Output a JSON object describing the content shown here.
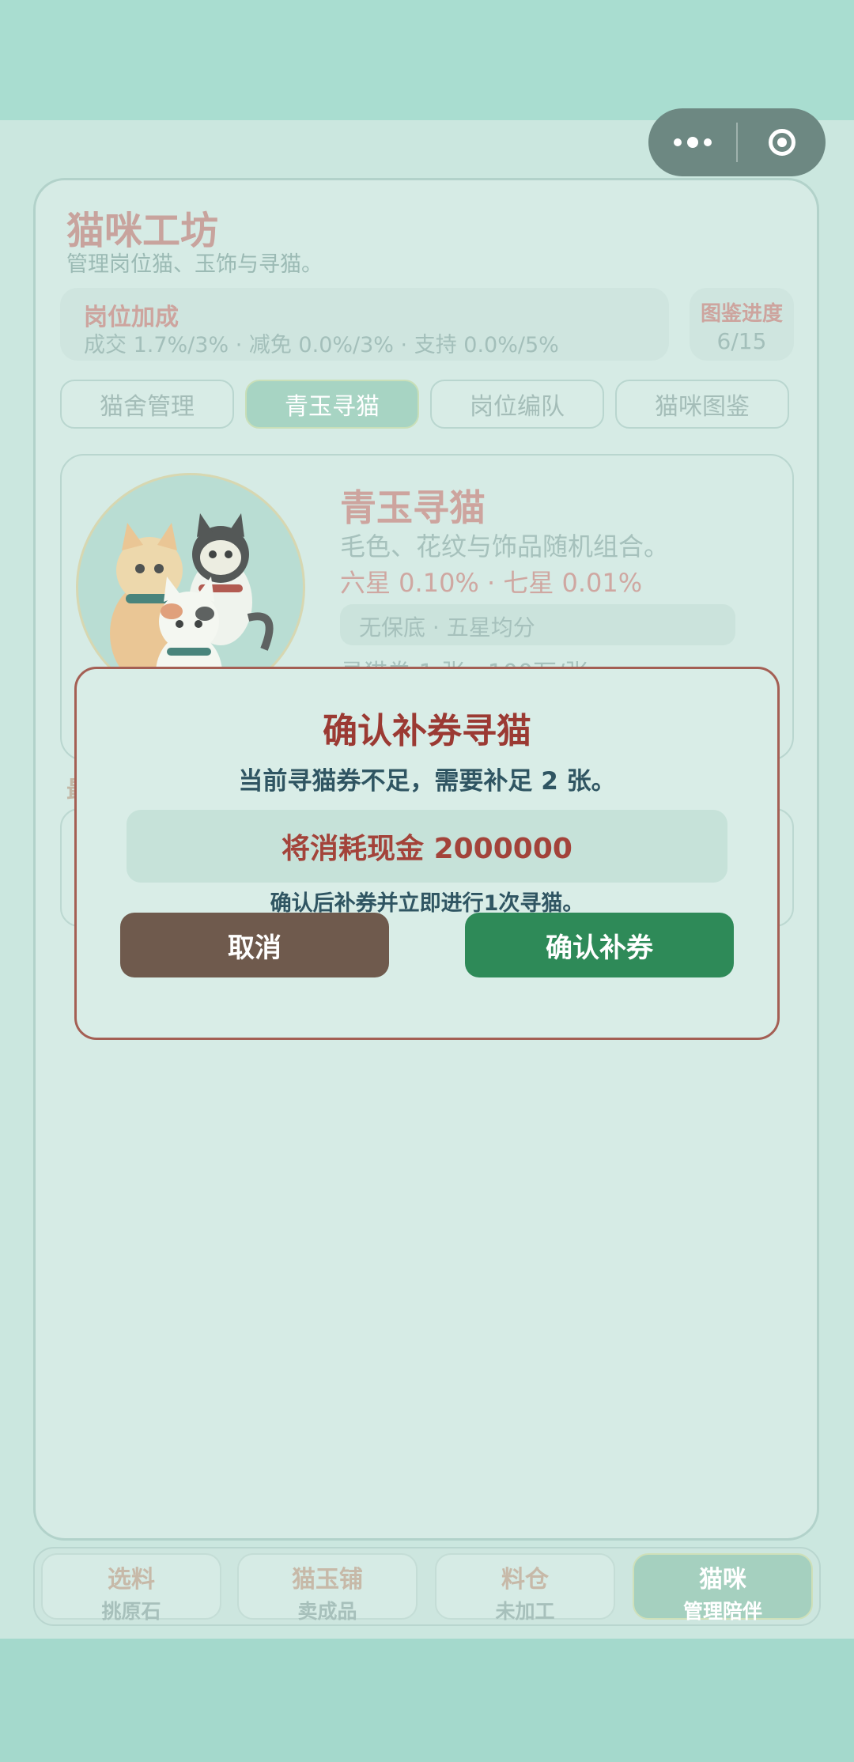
{
  "header": {
    "title": "猫咪工坊",
    "subtitle": "管理岗位猫、玉饰与寻猫。"
  },
  "capsule": {
    "more_icon": "more-dots-icon",
    "close_icon": "target-circle-icon"
  },
  "bonus": {
    "label": "岗位加成",
    "stats": "成交 1.7%/3% · 减免 0.0%/3% · 支持 0.0%/5%"
  },
  "codex": {
    "label": "图鉴进度",
    "value": "6/15"
  },
  "tabs": [
    {
      "label": "猫舍管理"
    },
    {
      "label": "青玉寻猫",
      "active": true
    },
    {
      "label": "岗位编队"
    },
    {
      "label": "猫咪图鉴"
    }
  ],
  "gacha": {
    "title": "青玉寻猫",
    "desc": "毛色、花纹与饰品随机组合。",
    "rates": "六星 0.10% · 七星 0.01%",
    "chip": "无保底 · 五星均分",
    "cost": "寻猫券 1 张 · 100万/张"
  },
  "recent_label": "最",
  "modal": {
    "title": "确认补券寻猫",
    "message": "当前寻猫券不足，需要补足 2 张。",
    "cost": "将消耗现金 2000000",
    "note": "确认后补券并立即进行1次寻猫。",
    "cancel": "取消",
    "confirm": "确认补券"
  },
  "bottom_nav": [
    {
      "title": "选料",
      "sub": "挑原石"
    },
    {
      "title": "猫玉铺",
      "sub": "卖成品"
    },
    {
      "title": "料仓",
      "sub": "未加工"
    },
    {
      "title": "猫咪",
      "sub": "管理陪伴",
      "active": true
    }
  ],
  "colors": {
    "modal_title": "#9b3a33",
    "confirm_button": "#2e8a58",
    "cancel_button": "#6f5a4d",
    "accent_teal": "#a7d4c3"
  }
}
